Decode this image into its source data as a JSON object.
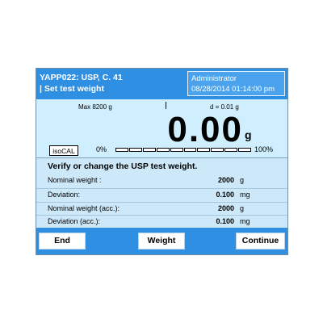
{
  "title": {
    "line1": "YAPP022: USP, C. 41",
    "line2": "| Set test weight",
    "user": "Administrator",
    "datetime": "08/28/2014 01:14:00 pm"
  },
  "weighing": {
    "max": "Max 8200 g",
    "readability": "d = 0.01 g",
    "value": "0.00",
    "unit": "g",
    "isocal_label": "isoCAL",
    "progress_start": "0%",
    "progress_end": "100%",
    "progress_fraction": 0.0
  },
  "info": {
    "instruction": "Verify or change the USP test weight.",
    "rows": [
      {
        "label": "Nominal weight :",
        "value": "2000",
        "unit": "g"
      },
      {
        "label": "Deviation:",
        "value": "0.100",
        "unit": "mg"
      },
      {
        "label": "Nominal weight (acc.):",
        "value": "2000",
        "unit": "g"
      },
      {
        "label": "Deviation (acc.):",
        "value": "0.100",
        "unit": "mg"
      }
    ]
  },
  "buttons": {
    "end": "End",
    "weight": "Weight",
    "continue": "Continue"
  },
  "colors": {
    "title_bar": "#2f8fe3",
    "screen_bg": "#cde9f9",
    "button_bar": "#2f8fe3"
  }
}
